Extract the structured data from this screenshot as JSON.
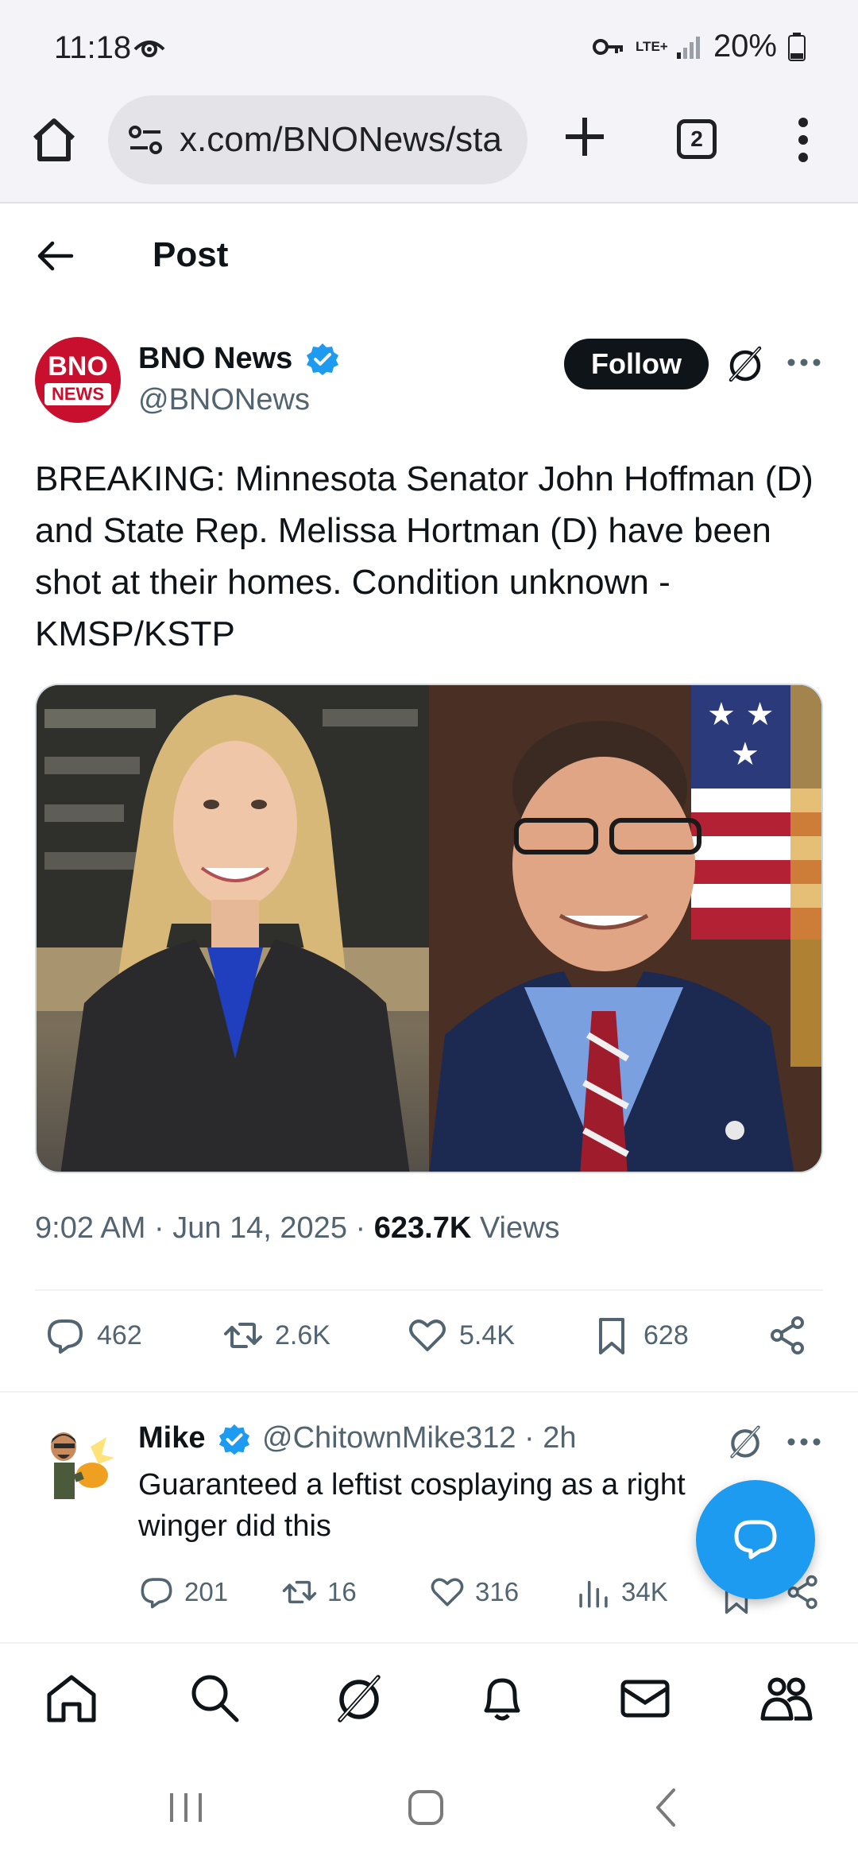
{
  "status_bar": {
    "time": "11:18",
    "network": "LTE+",
    "battery": "20%",
    "icons": [
      "eye-icon",
      "vpn-key-icon",
      "signal-icon",
      "battery-icon"
    ]
  },
  "browser": {
    "url": "x.com/BNONews/sta",
    "tab_count": "2"
  },
  "page": {
    "title": "Post"
  },
  "post": {
    "author_name": "BNO News",
    "author_handle": "@BNONews",
    "avatar_text_top": "BNO",
    "avatar_text_bottom": "NEWS",
    "follow_label": "Follow",
    "text": "BREAKING: Minnesota Senator John Hoffman (D) and State Rep. Melissa Hortman (D) have been shot at their homes. Condition unknown - KMSP/KSTP",
    "time": "9:02 AM",
    "date": "Jun 14, 2025",
    "views_count": "623.7K",
    "views_label": "Views",
    "stats": {
      "replies": "462",
      "reposts": "2.6K",
      "likes": "5.4K",
      "bookmarks": "628"
    }
  },
  "reply": {
    "name": "Mike",
    "handle_time": "@ChitownMike312 · 2h",
    "text": "Guaranteed a leftist cosplaying as a right winger did this",
    "stats": {
      "replies": "201",
      "reposts": "16",
      "likes": "316",
      "views": "34K"
    }
  },
  "colors": {
    "accent": "#1d9bf0",
    "text": "#0f1419",
    "secondary": "#536471",
    "bno_red": "#c8102e"
  }
}
